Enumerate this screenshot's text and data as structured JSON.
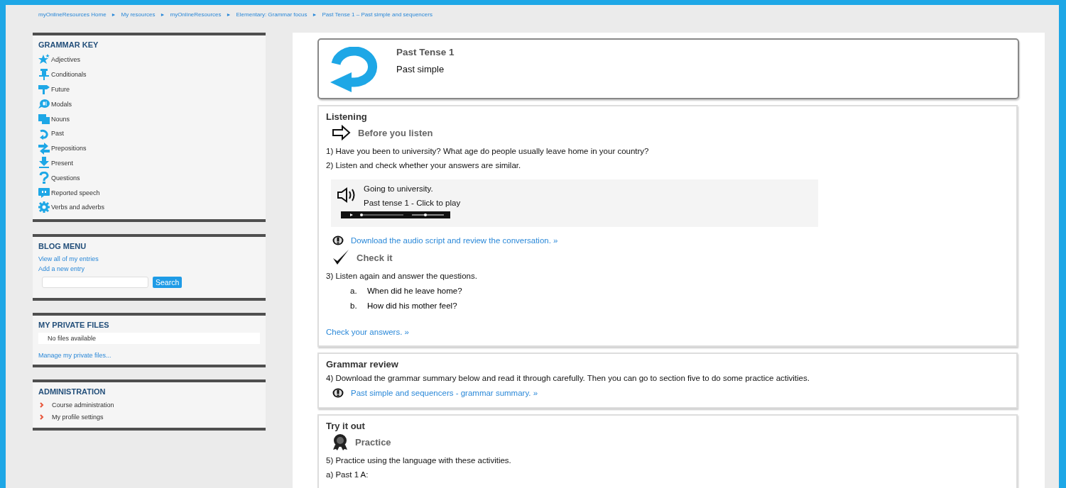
{
  "breadcrumb": [
    "myOnlineResources Home",
    "My resources",
    "myOnlineResources",
    "Elementary: Grammar focus",
    "Past Tense 1 – Past simple and sequencers"
  ],
  "breadcrumb_separator": "►",
  "sidebar": {
    "grammar_key": {
      "title": "GRAMMAR KEY",
      "items": [
        "Adjectives",
        "Conditionals",
        "Future",
        "Modals",
        "Nouns",
        "Past",
        "Prepositions",
        "Present",
        "Questions",
        "Reported speech",
        "Verbs and adverbs"
      ]
    },
    "blog_menu": {
      "title": "BLOG MENU",
      "links": [
        "View all of my entries",
        "Add a new entry"
      ],
      "search_button": "Search"
    },
    "private_files": {
      "title": "MY PRIVATE FILES",
      "empty_text": "No files available",
      "manage_link": "Manage my private files..."
    },
    "administration": {
      "title": "ADMINISTRATION",
      "items": [
        "Course administration",
        "My profile settings"
      ]
    }
  },
  "header_card": {
    "title": "Past Tense 1",
    "subtitle": "Past simple"
  },
  "sections": [
    {
      "title": "Listening",
      "blocks": [
        {
          "kind": "subheading",
          "text": "Before you listen"
        },
        {
          "kind": "paragraph",
          "text": "1) Have you been to university? What age do people usually leave home in your country?"
        },
        {
          "kind": "paragraph",
          "text": "2) Listen and check whether your answers are similar."
        },
        {
          "kind": "audio",
          "title": "Going to university.",
          "caption": "Past tense 1 - Click to play"
        },
        {
          "kind": "download",
          "text": "Download the audio script and review the conversation. »"
        },
        {
          "kind": "subheading",
          "text": "Check it"
        },
        {
          "kind": "paragraph",
          "text": "3) Listen again and answer the questions."
        },
        {
          "kind": "list",
          "items": [
            {
              "marker": "a.",
              "text": "When did he leave home?"
            },
            {
              "marker": "b.",
              "text": "How did his mother feel?"
            }
          ]
        },
        {
          "kind": "link",
          "text": "Check your answers. »"
        }
      ]
    },
    {
      "title": "Grammar review",
      "blocks": [
        {
          "kind": "paragraph",
          "text": "4) Download the grammar summary below and read it through carefully. Then you can go to section five to do some practice activities."
        },
        {
          "kind": "download",
          "text": "Past simple and sequencers - grammar summary. »"
        }
      ]
    },
    {
      "title": "Try it out",
      "blocks": [
        {
          "kind": "subheading",
          "text": "Practice"
        },
        {
          "kind": "paragraph",
          "text": "5) Practice using the language with these activities."
        },
        {
          "kind": "paragraph",
          "text": "a) Past 1 A:"
        }
      ]
    }
  ]
}
